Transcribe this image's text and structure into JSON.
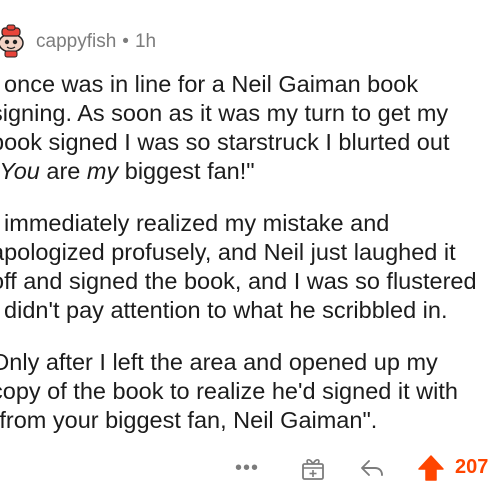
{
  "comment": {
    "author": "cappyfish",
    "separator": "•",
    "age": "1h",
    "paragraphs": [
      [
        "I once was in line for a Neil Gaiman book",
        "signing. As soon as it was my turn to get my",
        "book signed I was so starstruck I blurted out"
      ],
      [
        "I immediately realized my mistake and",
        "apologized profusely, and Neil just laughed it",
        "off and signed the book, and I was so flustered",
        "I didn't pay attention to what he scribbled in."
      ],
      [
        "Only after I left the area and opened up my",
        "copy of the book to realize he'd signed it with",
        "\"from your biggest fan, Neil Gaiman\"."
      ]
    ],
    "quote_line": {
      "open": "\"",
      "you": "You",
      "mid1": " are ",
      "my": "my",
      "rest": " biggest fan!\""
    }
  },
  "actions": {
    "more_label": "•••",
    "more_icon": "more-options-icon",
    "award_icon": "award-icon",
    "reply_icon": "reply-icon",
    "upvote_icon": "upvote-icon",
    "score": "207"
  },
  "colors": {
    "text": "#1c1c1c",
    "meta": "#7c7c7c",
    "upvote": "#ff4500"
  }
}
